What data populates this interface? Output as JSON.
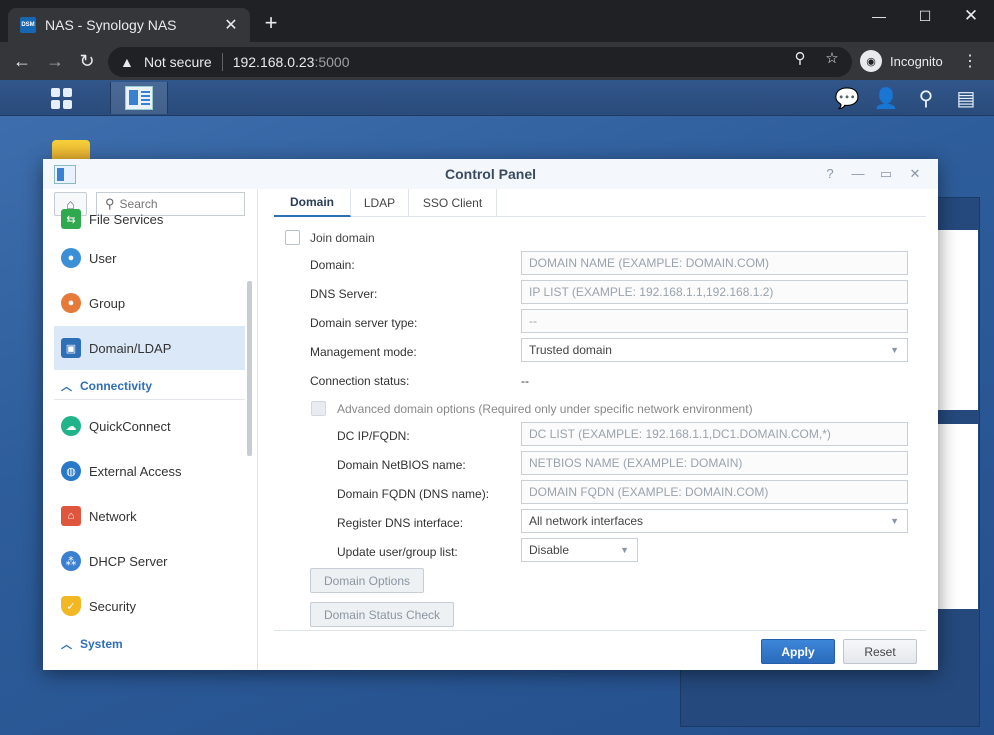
{
  "browser": {
    "tab_title": "NAS - Synology NAS",
    "favicon_text": "DSM",
    "security_label": "Not secure",
    "url_host": "192.168.0.23",
    "url_port": ":5000",
    "incognito_label": "Incognito"
  },
  "control_panel": {
    "title": "Control Panel",
    "search_placeholder": "Search",
    "sidebar": {
      "items": [
        {
          "label": "File Services",
          "icon": "file-services-icon"
        },
        {
          "label": "User",
          "icon": "user-icon"
        },
        {
          "label": "Group",
          "icon": "group-icon"
        },
        {
          "label": "Domain/LDAP",
          "icon": "domain-ldap-icon"
        },
        {
          "label": "QuickConnect",
          "icon": "quickconnect-icon"
        },
        {
          "label": "External Access",
          "icon": "external-access-icon"
        },
        {
          "label": "Network",
          "icon": "network-icon"
        },
        {
          "label": "DHCP Server",
          "icon": "dhcp-server-icon"
        },
        {
          "label": "Security",
          "icon": "security-icon"
        }
      ],
      "sections": {
        "connectivity": "Connectivity",
        "system": "System"
      },
      "selected": "Domain/LDAP"
    },
    "tabs": [
      "Domain",
      "LDAP",
      "SSO Client"
    ],
    "active_tab": "Domain",
    "form": {
      "join_domain_label": "Join domain",
      "domain_label": "Domain:",
      "domain_placeholder": "DOMAIN NAME (EXAMPLE: DOMAIN.COM)",
      "dns_label": "DNS Server:",
      "dns_placeholder": "IP LIST (EXAMPLE: 192.168.1.1,192.168.1.2)",
      "server_type_label": "Domain server type:",
      "server_type_value": "--",
      "mgmt_label": "Management mode:",
      "mgmt_value": "Trusted domain",
      "conn_status_label": "Connection status:",
      "conn_status_value": "--",
      "advanced_label": "Advanced domain options (Required only under specific network environment)",
      "dc_label": "DC IP/FQDN:",
      "dc_placeholder": "DC LIST (EXAMPLE: 192.168.1.1,DC1.DOMAIN.COM,*)",
      "netbios_label": "Domain NetBIOS name:",
      "netbios_placeholder": "NETBIOS NAME (EXAMPLE: DOMAIN)",
      "fqdn_label": "Domain FQDN (DNS name):",
      "fqdn_placeholder": "DOMAIN FQDN (EXAMPLE: DOMAIN.COM)",
      "dns_iface_label": "Register DNS interface:",
      "dns_iface_value": "All network interfaces",
      "update_label": "Update user/group list:",
      "update_value": "Disable",
      "domain_options_btn": "Domain Options",
      "status_check_btn": "Domain Status Check"
    },
    "footer": {
      "apply": "Apply",
      "reset": "Reset"
    }
  },
  "colors": {
    "accent": "#2f6fb5",
    "desktop": "#2e5d9b",
    "apply": "#2a6bbd"
  }
}
